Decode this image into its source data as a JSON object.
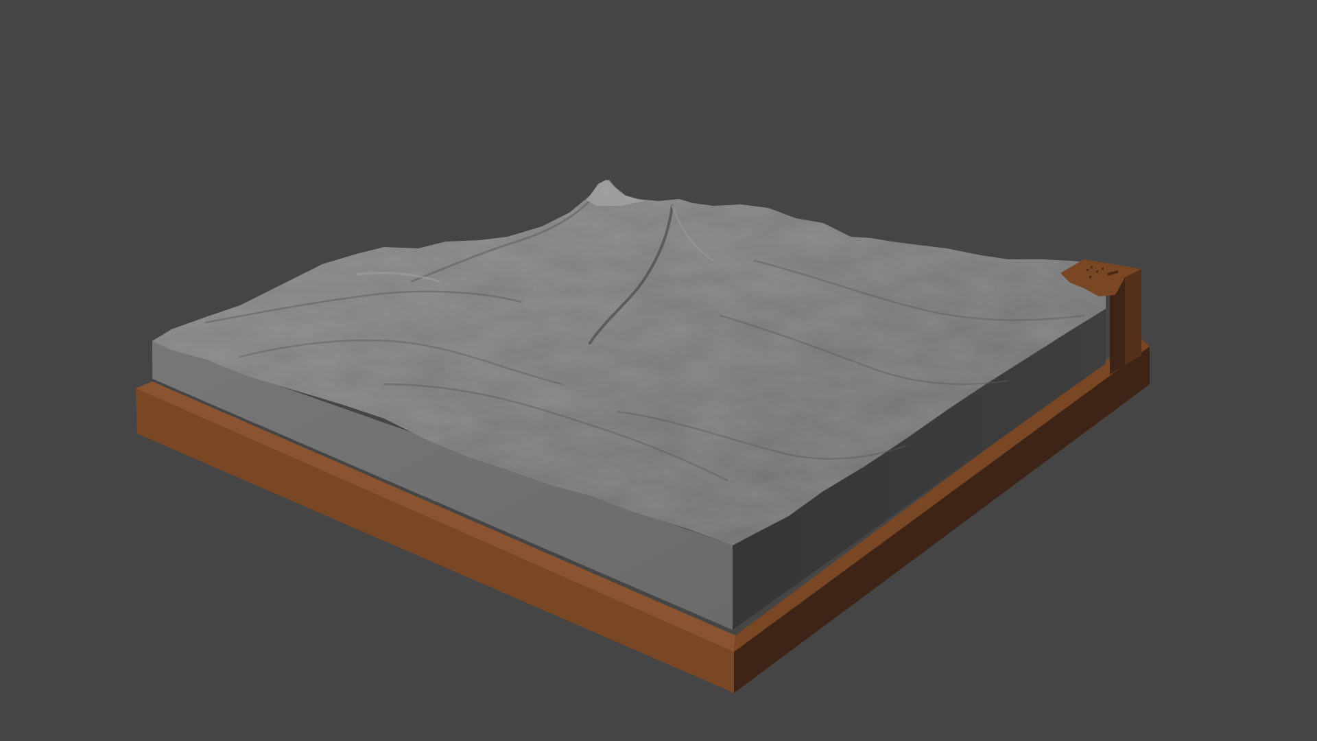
{
  "scene": {
    "background_color": "#454545",
    "terrain_color": "#7a7a7a",
    "terrain_side_color": "#707070",
    "terrain_shadow_side_color": "#3a3a3a",
    "base_color": "#7a4725",
    "base_dark_color": "#3d2417"
  }
}
